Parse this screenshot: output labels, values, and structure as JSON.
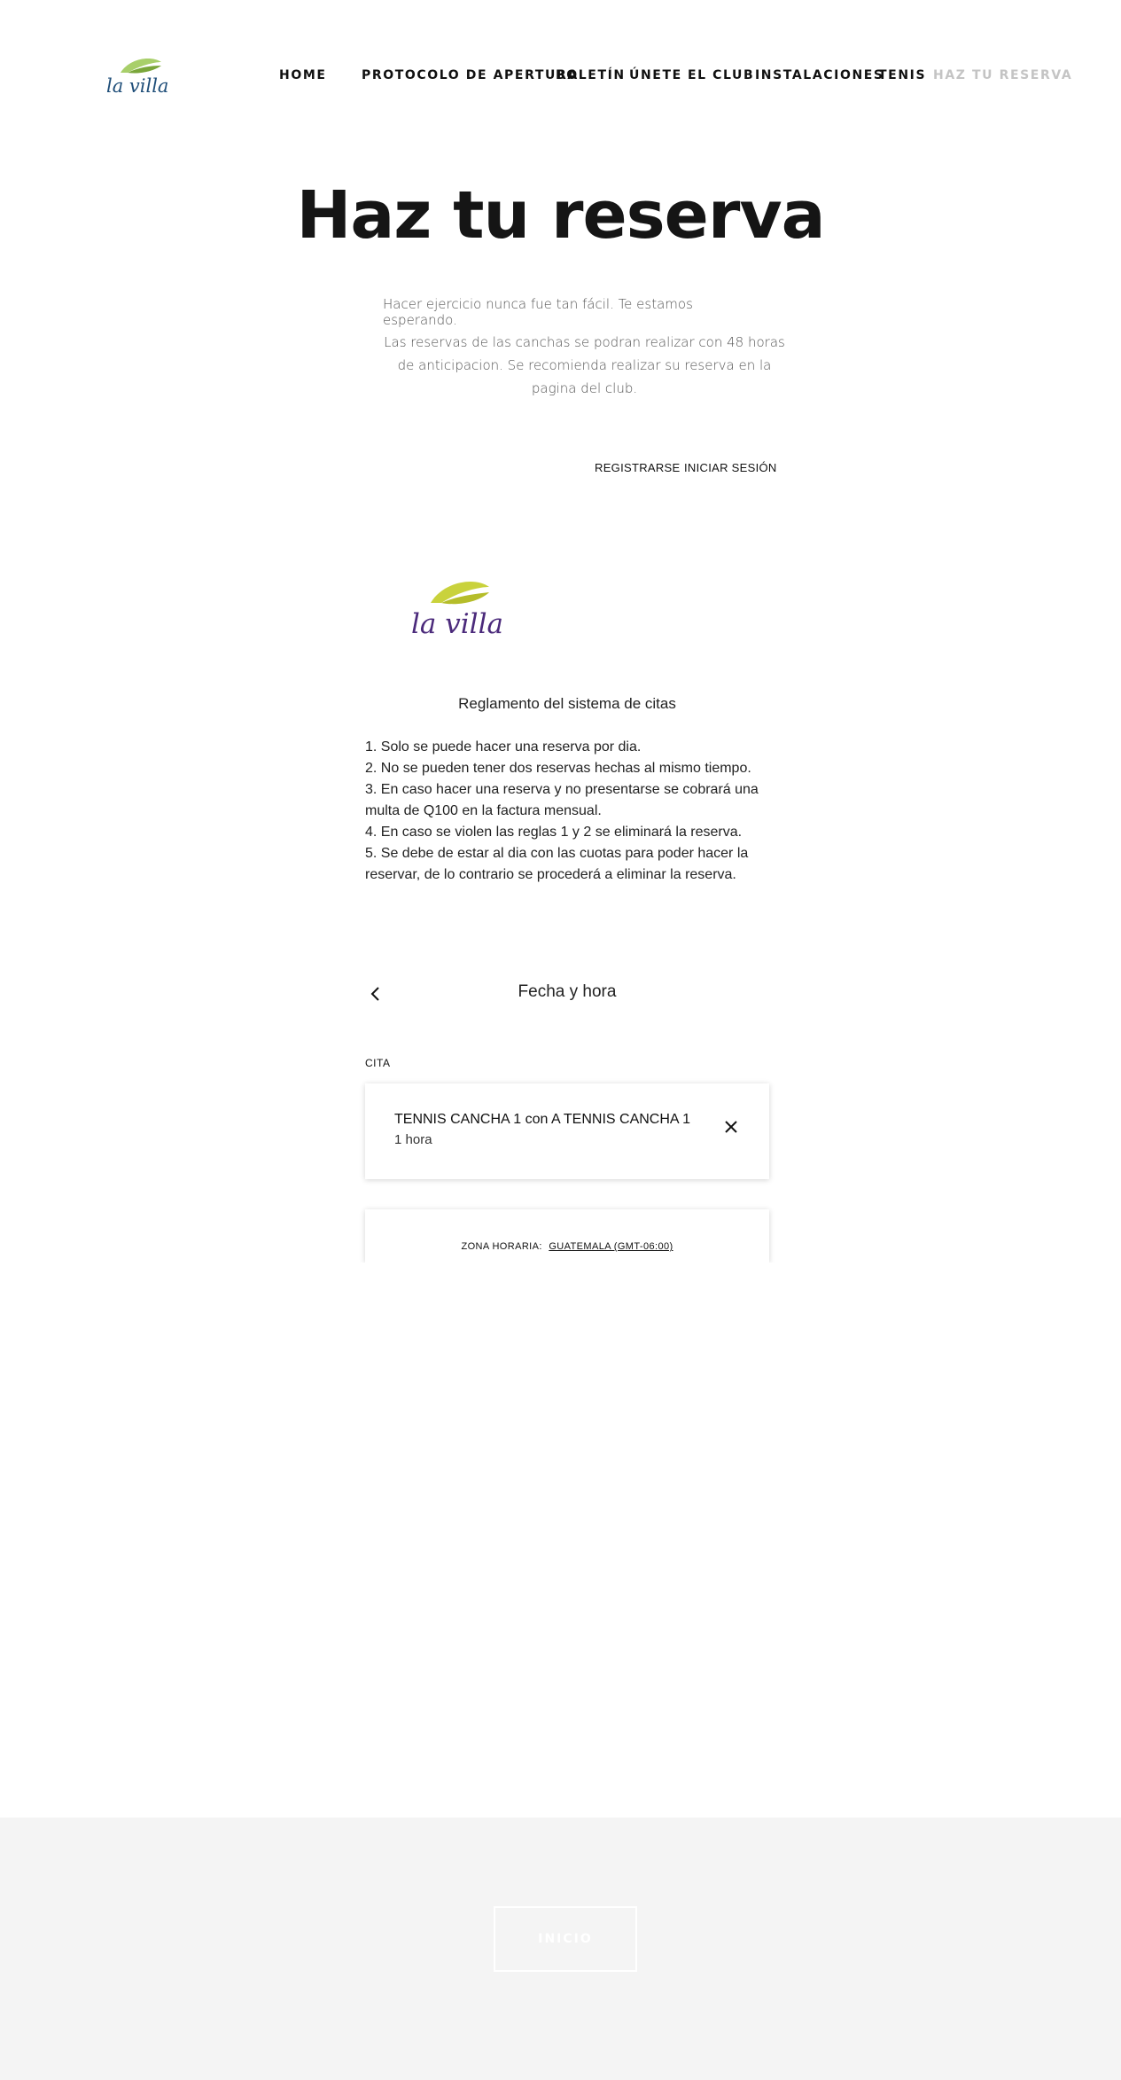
{
  "colors": {
    "logo_leaf_light": "#a8cf6a",
    "logo_leaf_dark": "#7aa63a",
    "logo_text_header": "#1f4e79",
    "logo_widget_leaf": "#c9d23c",
    "logo_widget_text": "#4b2a7b",
    "nav_active": "#c4c4c4",
    "footer_bg": "#f4f4f4"
  },
  "header": {
    "logo_text": "la villa",
    "nav": [
      {
        "label": "HOME",
        "active": false
      },
      {
        "label": "PROTOCOLO DE APERTURA",
        "active": false
      },
      {
        "label": "BOLETÍN",
        "active": false
      },
      {
        "label": "ÚNETE",
        "active": false
      },
      {
        "label": "EL CLUB",
        "active": false
      },
      {
        "label": "INSTALACIONES",
        "active": false
      },
      {
        "label": "TENIS",
        "active": false
      },
      {
        "label": "HAZ TU RESERVA",
        "active": true
      }
    ]
  },
  "hero": {
    "title": "Haz tu reserva",
    "subtitle": "Hacer ejercicio nunca fue tan fácil. Te estamos esperando.",
    "description": "Las reservas de las canchas se podran realizar con 48 horas de anticipacion. Se recomienda realizar su reserva en la pagina del club."
  },
  "scheduler": {
    "register_label": "REGISTRARSE",
    "login_label": "INICIAR SESIÓN",
    "logo_text": "la villa",
    "rules_title": "Reglamento del sistema de citas",
    "rules": [
      "1. Solo se puede hacer una reserva por dia.",
      "2. No se pueden tener dos reservas hechas al mismo tiempo.",
      "3. En caso hacer una reserva y no presentarse se cobrará una multa de Q100 en la factura mensual.",
      "4. En caso se violen las reglas 1 y 2 se eliminará la reserva.",
      "5. Se debe de estar al dia con las cuotas para poder hacer la reservar, de lo contrario se procederá a eliminar la reserva."
    ],
    "step_title": "Fecha y hora",
    "back_icon": "chevron-left-icon",
    "appointment_label": "CITA",
    "appointment_name": "TENNIS CANCHA 1 con A TENNIS CANCHA 1",
    "appointment_duration": "1 hora",
    "close_icon": "close-icon",
    "timezone_label": "ZONA HORARIA:",
    "timezone_value": "GUATEMALA (GMT-06:00)"
  },
  "footer": {
    "button_label": "INICIO"
  }
}
